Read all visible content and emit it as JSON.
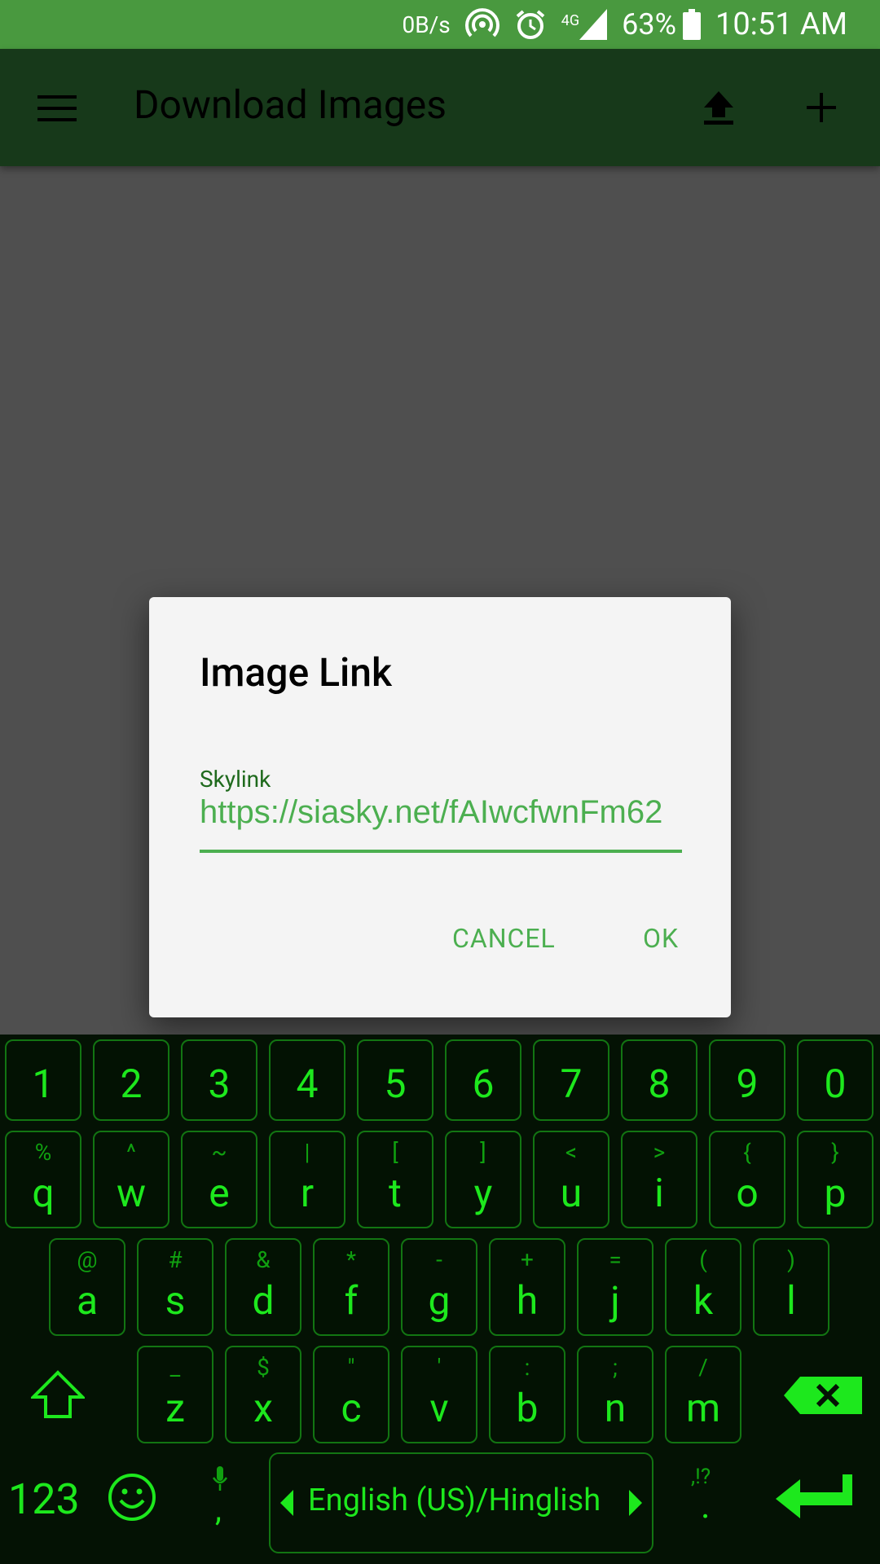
{
  "status_bar": {
    "speed": "0B/s",
    "network": "4G",
    "battery": "63%",
    "time": "10:51 AM"
  },
  "app_bar": {
    "title": "Download Images"
  },
  "dialog": {
    "title": "Image Link",
    "field_label": "Skylink",
    "field_value": "https://siasky.net/fAIwcfwnFm62",
    "cancel": "CANCEL",
    "ok": "OK"
  },
  "keyboard": {
    "numbers": [
      "1",
      "2",
      "3",
      "4",
      "5",
      "6",
      "7",
      "8",
      "9",
      "0"
    ],
    "row1": [
      {
        "k": "q",
        "s": "%"
      },
      {
        "k": "w",
        "s": "^"
      },
      {
        "k": "e",
        "s": "~"
      },
      {
        "k": "r",
        "s": "|"
      },
      {
        "k": "t",
        "s": "["
      },
      {
        "k": "y",
        "s": "]"
      },
      {
        "k": "u",
        "s": "<"
      },
      {
        "k": "i",
        "s": ">"
      },
      {
        "k": "o",
        "s": "{"
      },
      {
        "k": "p",
        "s": "}"
      }
    ],
    "row2": [
      {
        "k": "a",
        "s": "@"
      },
      {
        "k": "s",
        "s": "#"
      },
      {
        "k": "d",
        "s": "&"
      },
      {
        "k": "f",
        "s": "*"
      },
      {
        "k": "g",
        "s": "-"
      },
      {
        "k": "h",
        "s": "+"
      },
      {
        "k": "j",
        "s": "="
      },
      {
        "k": "k",
        "s": "("
      },
      {
        "k": "l",
        "s": ")"
      }
    ],
    "row3": [
      {
        "k": "z",
        "s": "_"
      },
      {
        "k": "x",
        "s": "$"
      },
      {
        "k": "c",
        "s": "\""
      },
      {
        "k": "v",
        "s": "'"
      },
      {
        "k": "b",
        "s": ":"
      },
      {
        "k": "n",
        "s": ";"
      },
      {
        "k": "m",
        "s": "/"
      }
    ],
    "symbols_key": "123",
    "comma": ",",
    "language": "English (US)/Hinglish",
    "punct_hint": ",!?",
    "period": "."
  }
}
